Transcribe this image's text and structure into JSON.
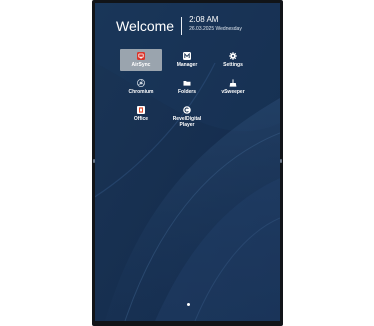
{
  "header": {
    "welcome": "Welcome",
    "time": "2:08 AM",
    "date": "26.03.2025 Wednesday"
  },
  "apps": [
    {
      "label": "AirSync",
      "icon": "airsync-icon",
      "selected": true
    },
    {
      "label": "Manager",
      "icon": "manager-icon",
      "selected": false
    },
    {
      "label": "Settings",
      "icon": "gear-icon",
      "selected": false
    },
    {
      "label": "Chromium",
      "icon": "chromium-icon",
      "selected": false
    },
    {
      "label": "Folders",
      "icon": "folder-icon",
      "selected": false
    },
    {
      "label": "vSweeper",
      "icon": "broom-icon",
      "selected": false
    },
    {
      "label": "Office",
      "icon": "office-icon",
      "selected": false
    },
    {
      "label": "RevelDigital Player",
      "label_line1": "RevelDigital",
      "label_line2": "Player",
      "icon": "reveldigital-icon",
      "selected": false
    }
  ],
  "pager": {
    "current_page": 1,
    "total_pages": 1
  },
  "colors": {
    "background": "#17304f",
    "selected_tile": "#9aa4ae",
    "airsync_red": "#d9342b",
    "office_red": "#e04a2a"
  }
}
